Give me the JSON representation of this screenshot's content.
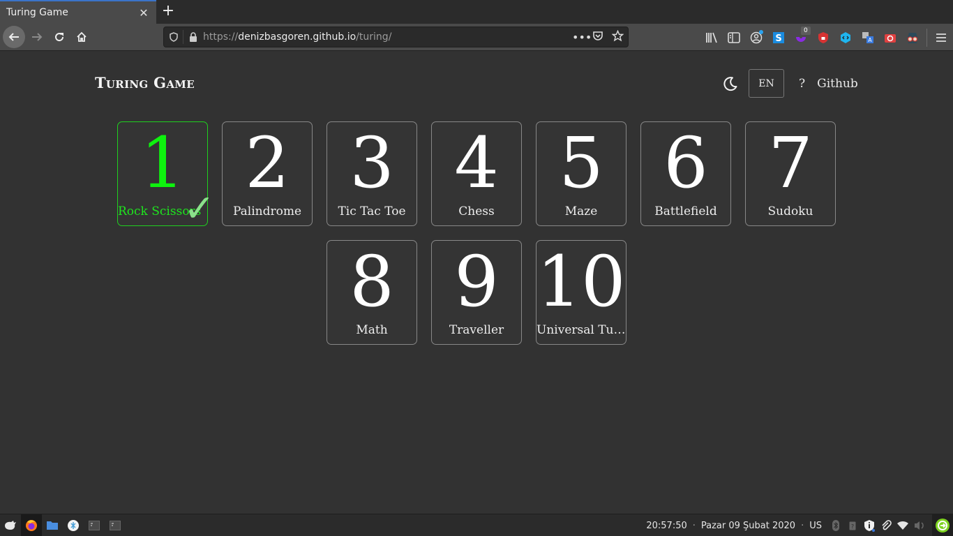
{
  "browser": {
    "tab": {
      "title": "Turing Game",
      "close_icon": "close-icon"
    },
    "new_tab_label": "+",
    "url": {
      "scheme": "https://",
      "host": "denizbasgoren.github.io",
      "path": "/turing/"
    },
    "url_actions": [
      "page-actions-icon",
      "pocket-icon",
      "bookmark-star-icon"
    ],
    "toolbar_badge_count": "0",
    "toolbar_extensions": [
      "library-icon",
      "sidebar-icon",
      "account-icon",
      "s-extension-icon",
      "purple-extension-icon",
      "red-shield-extension-icon",
      "cyan-extension-icon",
      "translate-extension-icon",
      "screenshot-extension-icon",
      "incognito-extension-icon",
      "menu-icon"
    ]
  },
  "site": {
    "title": "Turing Game",
    "nav": {
      "theme_icon": "moon-icon",
      "language": "EN",
      "help": "?",
      "github": "Github"
    }
  },
  "levels": [
    {
      "number": "1",
      "name": "Rock Scissors",
      "completed": true
    },
    {
      "number": "2",
      "name": "Palindrome",
      "completed": false
    },
    {
      "number": "3",
      "name": "Tic Tac Toe",
      "completed": false
    },
    {
      "number": "4",
      "name": "Chess",
      "completed": false
    },
    {
      "number": "5",
      "name": "Maze",
      "completed": false
    },
    {
      "number": "6",
      "name": "Battlefield",
      "completed": false
    },
    {
      "number": "7",
      "name": "Sudoku",
      "completed": false
    },
    {
      "number": "8",
      "name": "Math",
      "completed": false
    },
    {
      "number": "9",
      "name": "Traveller",
      "completed": false
    },
    {
      "number": "10",
      "name": "Universal Turing Machine",
      "completed": false
    }
  ],
  "completed_mark": "✓",
  "colors": {
    "completed": "#0ef20e",
    "check": "#8be08b",
    "card_border": "#888888",
    "background": "#323232"
  },
  "taskbar": {
    "apps": [
      "xfce-menu-icon",
      "firefox-icon",
      "file-manager-icon",
      "settings-icon",
      "terminal-icon",
      "terminal-icon"
    ],
    "time": "20:57:50",
    "date": "Pazar 09 Şubat 2020",
    "keyboard_layout": "US",
    "separator": "·"
  }
}
